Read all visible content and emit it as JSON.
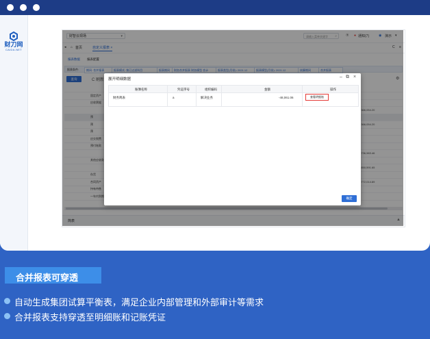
{
  "logo": {
    "brand": "财刀网",
    "sub": "CAIDA.NET"
  },
  "app": {
    "org_select": "财智云现场",
    "search_placeholder": "请输入菜单关键字",
    "help": "⑦",
    "notify": "通知(7)",
    "user": "演示",
    "nav": {
      "home": "首页",
      "custom_report": "自定义报表 ×"
    },
    "subtabs": [
      "报表数据",
      "报表配置"
    ],
    "filter_label": "报表条件:",
    "filters": [
      "期间: 合并报表",
      "报表模式: 按已过滤科目",
      "报表期间",
      "财务合并报表 财务模型 合计",
      "报表类型(月份): 2021.12",
      "报表模型(月份): 2021.12",
      "核算期间",
      "合并报表"
    ],
    "query_btn": "查询",
    "refresh": "C 刷新",
    "grid_rows": [
      {
        "c1": "",
        "c2": ""
      },
      {
        "c1": "固定资产",
        "c2": ""
      },
      {
        "c1": "应收票据",
        "c2": ""
      },
      {
        "c1": "",
        "c2": "-366,054.20"
      },
      {
        "c1": "预",
        "c2": ""
      },
      {
        "c1": "预",
        "c2": "-366,054.20"
      },
      {
        "c1": "预",
        "c2": ""
      },
      {
        "c1": "应交税费",
        "c2": ""
      },
      {
        "c1": "预付账款",
        "c2": ""
      },
      {
        "c1": "",
        "c2": "-736,983.46"
      },
      {
        "c1": "其他应收款",
        "c2": ""
      },
      {
        "c1": "",
        "c2": "-850,591.65"
      },
      {
        "c1": "存货",
        "c2": ""
      },
      {
        "c1": "合同资产",
        "c2": "-772,014.89"
      },
      {
        "c1": "持有待售",
        "c2": ""
      },
      {
        "c1": "一年内到期",
        "c2": ""
      },
      {
        "c1": "",
        "c2": ""
      }
    ],
    "bottom_label": "简表",
    "modal": {
      "title": "展开明细数据",
      "headers": [
        "账簿名称",
        "凭证序号",
        "组织编码",
        "金额",
        "操作"
      ],
      "row": {
        "book": "财务简表",
        "voucher": "a",
        "org": "解决业务",
        "amount": "-48,061.06",
        "action": "查看明细账"
      },
      "ok": "确定"
    }
  },
  "section_title": "合并报表可穿透",
  "bullets": [
    "自动生成集团试算平衡表，满足企业内部管理和外部审计等需求",
    "合并报表支持穿透至明细账和记账凭证"
  ]
}
